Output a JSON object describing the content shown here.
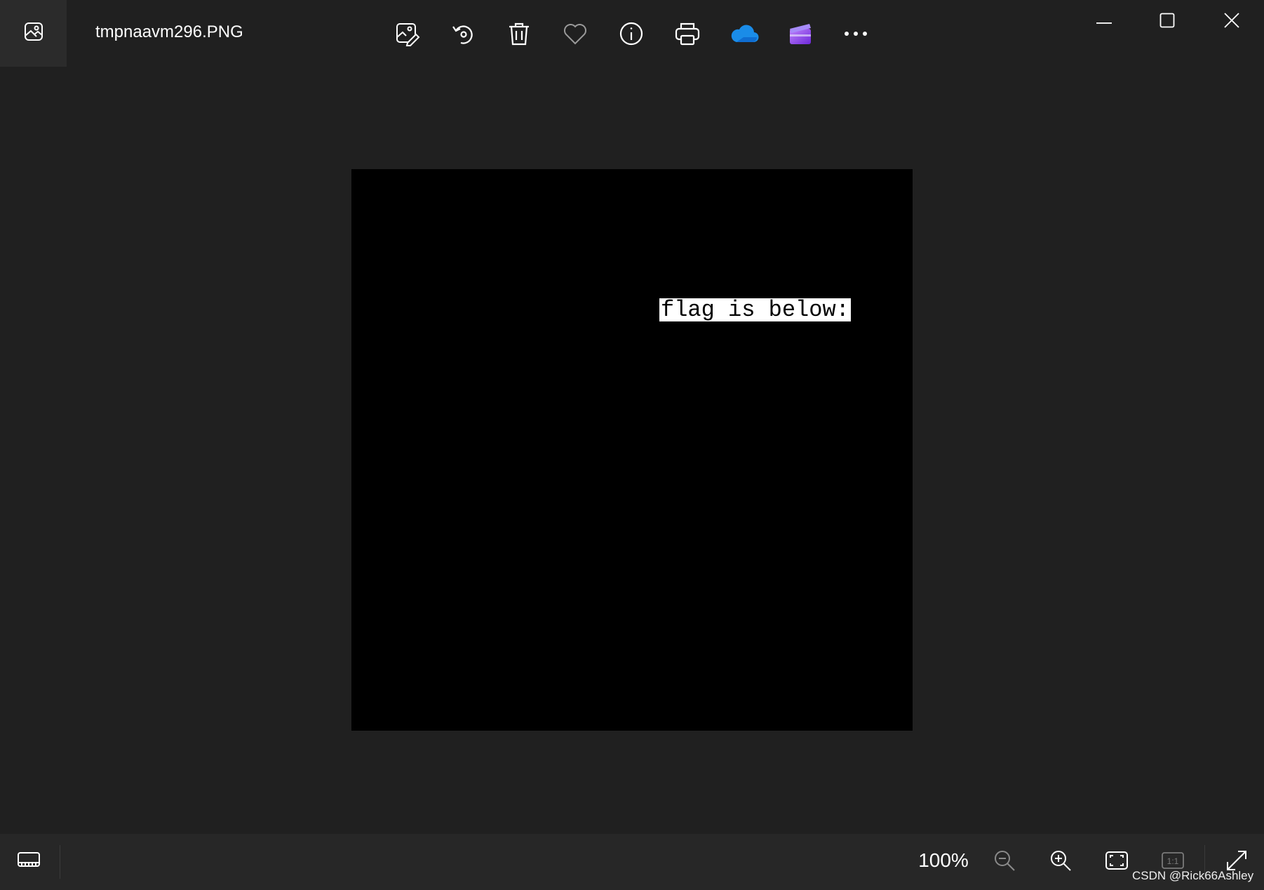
{
  "window": {
    "file_name": "tmpnaavm296.PNG"
  },
  "toolbar": {
    "buttons": [
      {
        "name": "edit-image",
        "icon": "edit-image-icon"
      },
      {
        "name": "rotate",
        "icon": "rotate-icon"
      },
      {
        "name": "delete",
        "icon": "trash-icon"
      },
      {
        "name": "favorite",
        "icon": "heart-icon"
      },
      {
        "name": "file-info",
        "icon": "info-icon"
      },
      {
        "name": "print",
        "icon": "printer-icon"
      },
      {
        "name": "onedrive",
        "icon": "onedrive-cloud-icon"
      },
      {
        "name": "clipchamp",
        "icon": "clipchamp-icon"
      },
      {
        "name": "see-more",
        "icon": "more-icon"
      }
    ],
    "window_controls": [
      "minimize-icon",
      "maximize-icon",
      "close-icon"
    ]
  },
  "image": {
    "text": "flag is below:",
    "background": "#000000",
    "text_color": "#000000",
    "text_background": "#ffffff"
  },
  "statusbar": {
    "zoom": "100%",
    "zoom_value_percent": 100,
    "icons": [
      "filmstrip-icon",
      "zoom-out-icon",
      "zoom-in-icon",
      "fit-to-window-icon",
      "actual-size-icon",
      "fullscreen-icon"
    ],
    "actual_size_label": "1:1"
  },
  "watermark": "CSDN @Rick66Ashley",
  "theme": {
    "background": "#202020",
    "statusbar_background": "#272727",
    "onedrive_blue": "#1a8ce8",
    "clipchamp_purple": "#8b5cf6"
  }
}
